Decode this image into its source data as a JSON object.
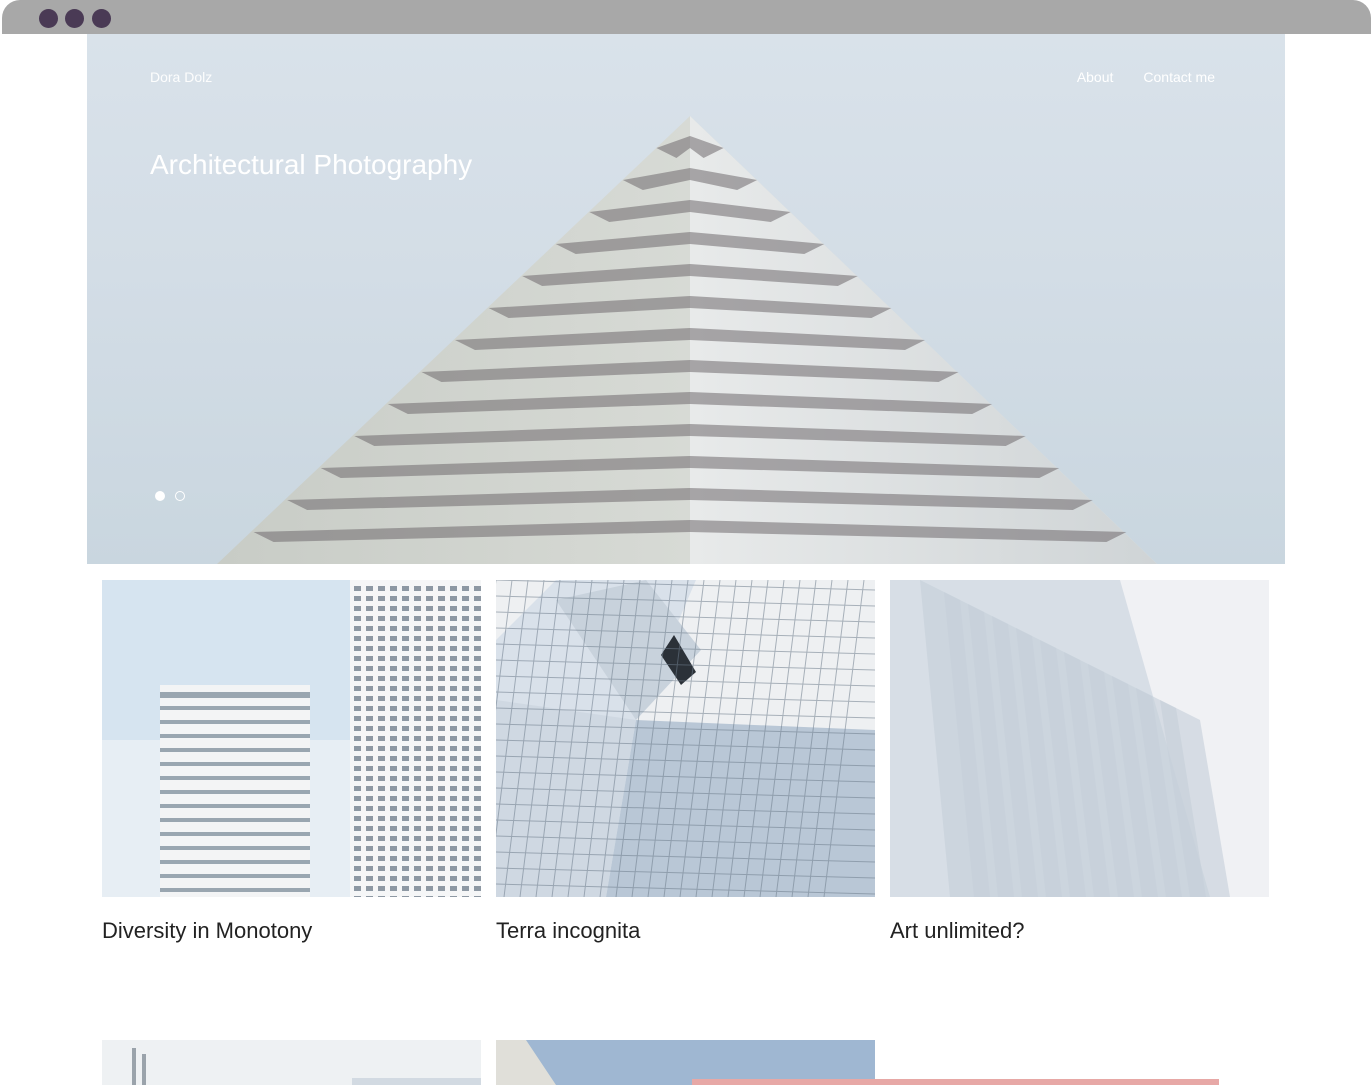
{
  "window": {
    "controls": [
      "window-dot",
      "window-dot",
      "window-dot"
    ]
  },
  "header": {
    "brand": "Dora Dolz",
    "nav": [
      {
        "label": "About"
      },
      {
        "label": "Contact me"
      }
    ]
  },
  "hero": {
    "title": "Architectural Photography",
    "slides_total": 2,
    "active_slide": 1
  },
  "gallery": [
    {
      "title": "Diversity in Monotony"
    },
    {
      "title": "Terra incognita"
    },
    {
      "title": "Art unlimited?"
    }
  ],
  "colors": {
    "window_bar": "#a8a8a8",
    "window_dots": "#4a3a55",
    "hero_sky": "#d3dde6",
    "text_dark": "#222222",
    "text_light": "#ffffff"
  }
}
